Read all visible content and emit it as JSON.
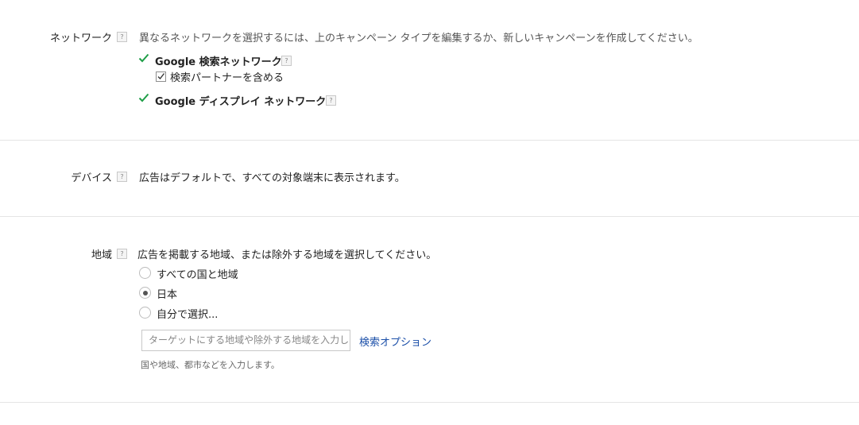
{
  "network": {
    "label": "ネットワーク",
    "help": "?",
    "description": "異なるネットワークを選択するには、上のキャンペーン タイプを編集するか、新しいキャンペーンを作成してください。",
    "search_network": {
      "label": "Google 検索ネットワーク",
      "help": "?",
      "partners_label": "検索パートナーを含める",
      "partners_checked": true
    },
    "display_network": {
      "label": "Google ディスプレイ ネットワーク",
      "help": "?"
    }
  },
  "devices": {
    "label": "デバイス",
    "help": "?",
    "description": "広告はデフォルトで、すべての対象端末に表示されます。"
  },
  "location": {
    "label": "地域",
    "help": "?",
    "description": "広告を掲載する地域、または除外する地域を選択してください。",
    "options": [
      {
        "label": "すべての国と地域",
        "selected": false
      },
      {
        "label": "日本",
        "selected": true
      },
      {
        "label": "自分で選択...",
        "selected": false
      }
    ],
    "search_placeholder": "ターゲットにする地域や除外する地域を入力し",
    "search_options_link": "検索オプション",
    "hint": "国や地域、都市などを入力します。"
  },
  "colors": {
    "check_green": "#1e9e47",
    "link_blue": "#1a4ea8",
    "divider": "#e5e5e5"
  }
}
